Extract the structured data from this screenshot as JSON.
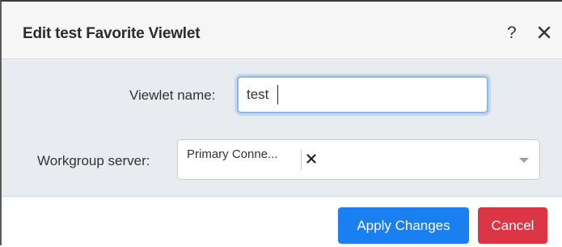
{
  "dialog": {
    "title": "Edit test Favorite Viewlet",
    "help_label": "?",
    "close_icon": "close-icon"
  },
  "form": {
    "viewlet_name_label": "Viewlet name:",
    "viewlet_name_value": "test",
    "workgroup_server_label": "Workgroup server:",
    "workgroup_server_selected": "Primary Conne...",
    "remove_icon": "close-icon",
    "dropdown_icon": "chevron-down-icon"
  },
  "footer": {
    "apply_label": "Apply Changes",
    "cancel_label": "Cancel"
  },
  "colors": {
    "apply": "#1a7ff0",
    "cancel": "#dc3545",
    "body_bg": "#e8ebf0",
    "focus_ring": "#8fb8e6"
  }
}
